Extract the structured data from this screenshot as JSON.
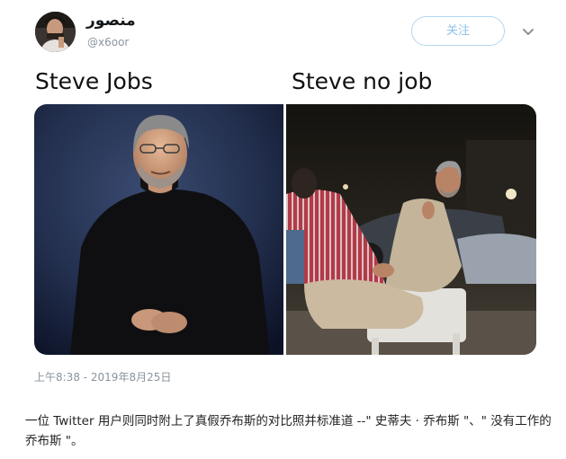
{
  "tweet": {
    "display_name": "منصور",
    "handle": "@x6oor",
    "follow_label": "关注",
    "timestamp": "上午8:38 - 2019年8月25日",
    "icons": {
      "avatar": "user-avatar",
      "menu": "chevron-down-icon"
    }
  },
  "meme": {
    "left_label": "Steve Jobs",
    "right_label": "Steve no job"
  },
  "caption": "一位 Twitter 用户则同时附上了真假乔布斯的对比照并标准道 --\" 史蒂夫 · 乔布斯 \"、\" 没有工作的乔布斯 \"。"
}
